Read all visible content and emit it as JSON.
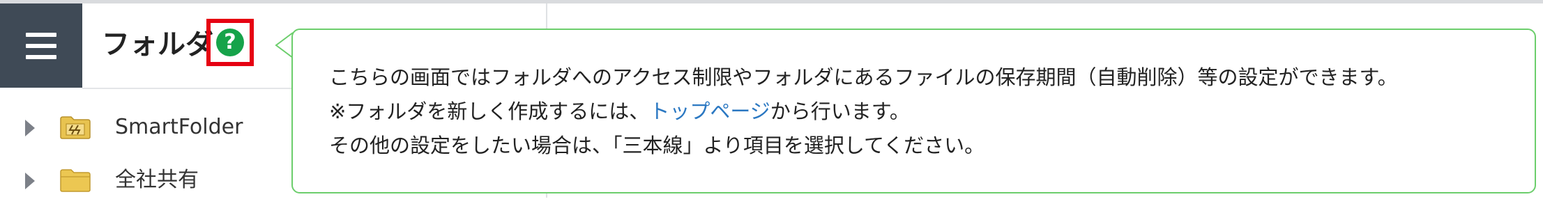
{
  "header": {
    "title": "フォルダ",
    "help_icon_glyph": "?"
  },
  "colors": {
    "menu_background": "#3f4a56",
    "help_icon": "#16a34a",
    "highlight_box": "#e60012",
    "tooltip_border": "#6cce6c",
    "link": "#2b78c2",
    "folder_icon": "#e8c350"
  },
  "sidebar": {
    "items": [
      {
        "label": "SmartFolder",
        "icon": "smart-folder-icon",
        "expanded": false
      },
      {
        "label": "全社共有",
        "icon": "folder-icon",
        "expanded": false
      }
    ]
  },
  "tooltip": {
    "line1": "こちらの画面ではフォルダへのアクセス制限やフォルダにあるファイルの保存期間（自動削除）等の設定ができます。",
    "line2_prefix": "※フォルダを新しく作成するには、",
    "line2_link": "トップページ",
    "line2_suffix": "から行います。",
    "line3": "その他の設定をしたい場合は、「三本線」より項目を選択してください。"
  }
}
